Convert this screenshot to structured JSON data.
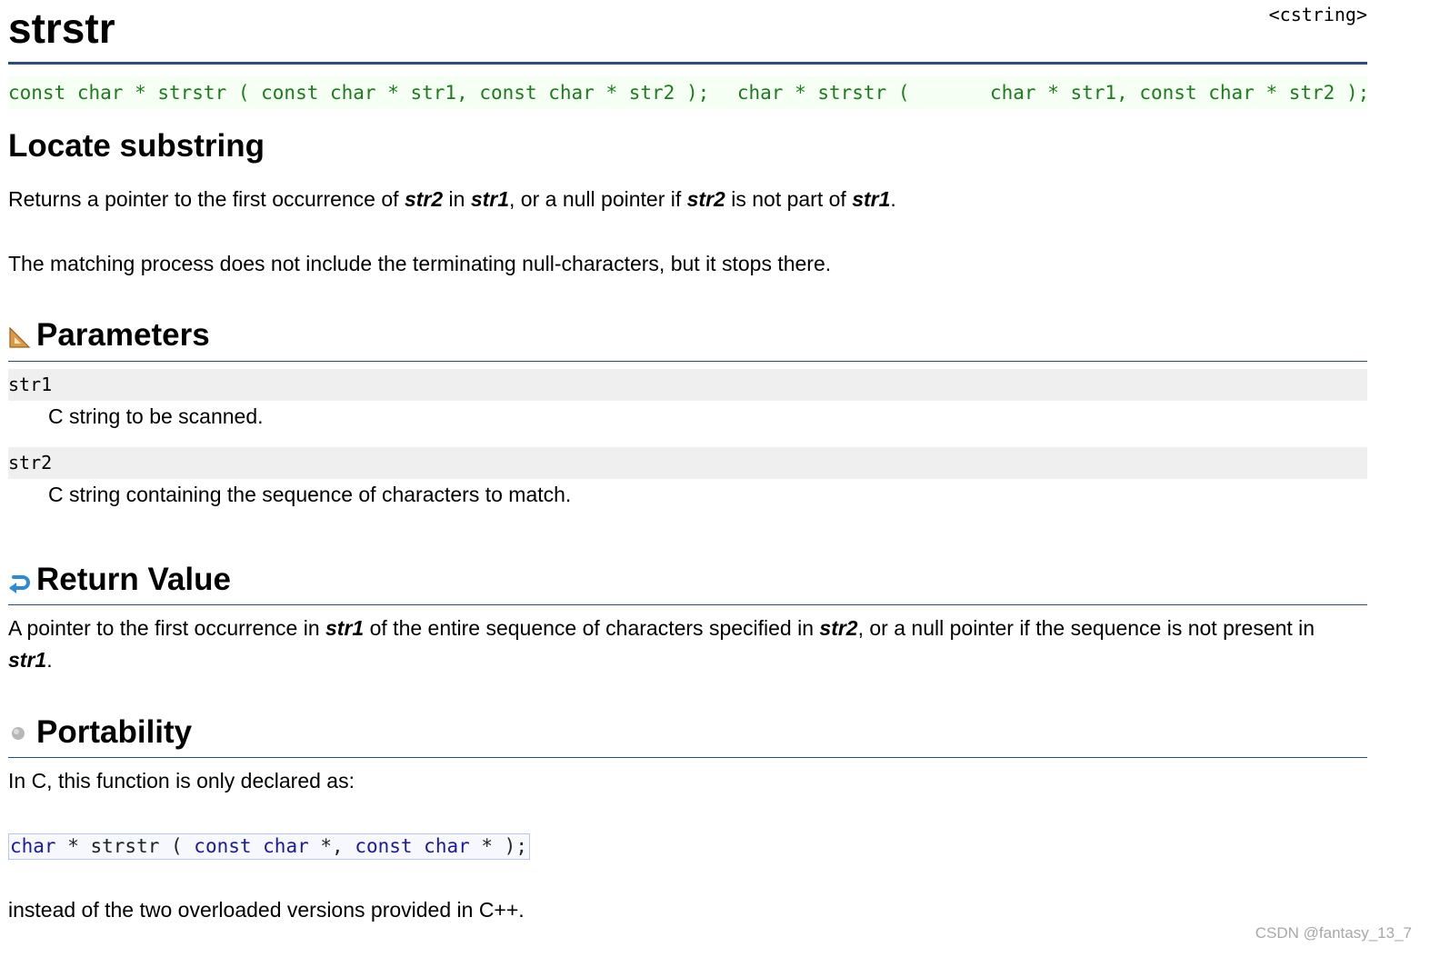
{
  "header": {
    "title": "strstr",
    "library": "<cstring>"
  },
  "prototypes": {
    "c_const": "const char * strstr ( const char * str1, const char * str2 );",
    "cpp_nonconst": "      char * strstr (       char * str1, const char * str2 );"
  },
  "summary": {
    "heading": "Locate substring",
    "p1": {
      "a": "Returns a pointer to the first occurrence of ",
      "b": "str2",
      "c": " in ",
      "d": "str1",
      "e": ", or a null pointer if ",
      "f": "str2",
      "g": " is not part of ",
      "h": "str1",
      "i": "."
    },
    "p2": "The matching process does not include the terminating null-characters, but it stops there."
  },
  "parameters": {
    "heading": "Parameters",
    "items": [
      {
        "name": "str1",
        "desc": "C string to be scanned."
      },
      {
        "name": "str2",
        "desc": "C string containing the sequence of characters to match."
      }
    ]
  },
  "return_value": {
    "heading": "Return Value",
    "p": {
      "a": "A pointer to the first occurrence in ",
      "b": "str1",
      "c": " of the entire sequence of characters specified in ",
      "d": "str2",
      "e": ", or a null pointer if the sequence is not present in",
      "f": "str1",
      "g": "."
    }
  },
  "portability": {
    "heading": "Portability",
    "intro": "In C, this function is only declared as:",
    "code": {
      "kw1": "char",
      "t1": " * strstr ( ",
      "kw2": "const char",
      "t2": " *, ",
      "kw3": "const char",
      "t3": " * );"
    },
    "outro": "instead of the two overloaded versions provided in C++."
  },
  "watermark": "CSDN @fantasy_13_7",
  "colors": {
    "rule": "#2b4c80",
    "prototype_text": "#1a7d1a",
    "prototype_bg": "#f6fff4",
    "param_bg": "#efefef",
    "code_keyword": "#1a1a9a"
  },
  "icons": {
    "parameters": "set-square-icon",
    "return_value": "return-arrow-icon",
    "portability": "gray-dot-icon"
  }
}
